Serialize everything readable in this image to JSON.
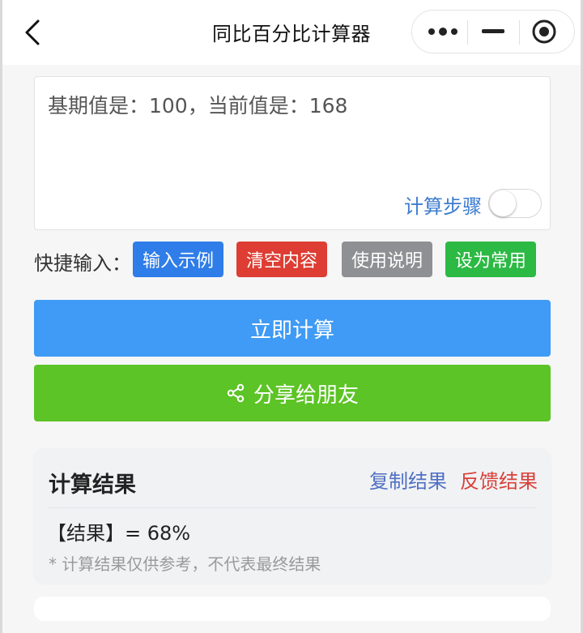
{
  "header": {
    "title": "同比百分比计算器",
    "back_icon": "chevron-left-icon",
    "capsule": {
      "more_icon": "more-dots-icon",
      "minimize_icon": "minimize-icon",
      "close_icon": "target-close-icon"
    }
  },
  "input": {
    "value": "基期值是：100，当前值是：168",
    "steps_label": "计算步骤",
    "steps_enabled": false
  },
  "quick_input": {
    "label": "快捷输入：",
    "buttons": [
      {
        "label": "输入示例",
        "color": "#2f7de8"
      },
      {
        "label": "清空内容",
        "color": "#dd3d33"
      },
      {
        "label": "使用说明",
        "color": "#8e9093"
      },
      {
        "label": "设为常用",
        "color": "#2cb944"
      }
    ]
  },
  "actions": {
    "calculate_label": "立即计算",
    "share_label": "分享给朋友",
    "share_icon": "share-icon"
  },
  "result": {
    "title": "计算结果",
    "copy_label": "复制结果",
    "feedback_label": "反馈结果",
    "value": "【结果】= 68%",
    "note": "* 计算结果仅供参考，不代表最终结果"
  },
  "colors": {
    "primary_blue": "#3f9bf5",
    "share_green": "#5cc426",
    "link_blue": "#4f6fc2",
    "link_red": "#d9403a"
  }
}
